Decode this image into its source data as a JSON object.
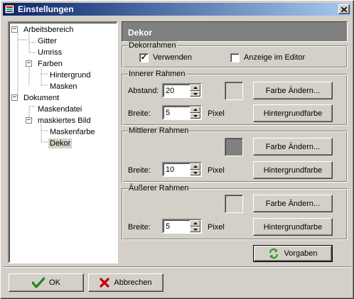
{
  "window": {
    "title": "Einstellungen"
  },
  "tree": {
    "items": [
      {
        "label": "Arbeitsbereich",
        "expander": "−"
      },
      {
        "label": "Gitter"
      },
      {
        "label": "Umriss"
      },
      {
        "label": "Farben",
        "expander": "−"
      },
      {
        "label": "Hintergrund"
      },
      {
        "label": "Masken"
      },
      {
        "label": "Dokument",
        "expander": "−"
      },
      {
        "label": "Maskendatei"
      },
      {
        "label": "maskiertes Bild",
        "expander": "−"
      },
      {
        "label": "Maskenfarbe"
      },
      {
        "label": "Dekor",
        "selected": true
      }
    ]
  },
  "panel": {
    "title": "Dekor"
  },
  "dekorrahmen": {
    "title": "Dekorrahmen",
    "use_label": "Verwenden",
    "use_checked": true,
    "editor_label": "Anzeige im Editor",
    "editor_checked": false
  },
  "inner": {
    "title": "Innerer Rahmen",
    "distance_label": "Abstand:",
    "distance_value": "20",
    "width_label": "Breite:",
    "width_value": "5",
    "unit": "Pixel",
    "change_color": "Farbe Ändern...",
    "background_color": "Hintergrundfarbe",
    "swatch_color": "#d4d0c8"
  },
  "middle": {
    "title": "Mittlerer Rahmen",
    "width_label": "Breite:",
    "width_value": "10",
    "unit": "Pixel",
    "change_color": "Farbe Ändern...",
    "background_color": "Hintergrundfarbe",
    "swatch_color": "#808080"
  },
  "outer": {
    "title": "Äußerer Rahmen",
    "width_label": "Breite:",
    "width_value": "5",
    "unit": "Pixel",
    "change_color": "Farbe Ändern...",
    "background_color": "Hintergrundfarbe",
    "swatch_color": "#d4d0c8"
  },
  "defaults_button": "Vorgaben",
  "footer": {
    "ok_label": "OK",
    "cancel_label": "Abbrechen"
  },
  "colors": {
    "ok_check": "#1a8a1a",
    "cancel_x": "#c00000",
    "refresh_icon": "#2e9e2e"
  }
}
